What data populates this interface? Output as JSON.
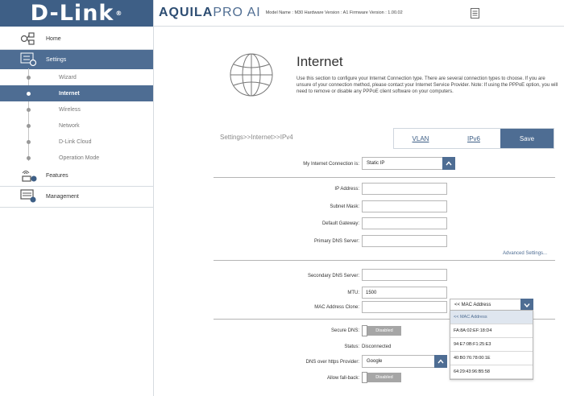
{
  "sidebar": {
    "logo": "D-Link",
    "logo_mark": "®",
    "items": [
      {
        "label": "Home",
        "icon": "home-network-icon"
      },
      {
        "label": "Settings",
        "icon": "settings-gear-icon"
      },
      {
        "label": "Features",
        "icon": "features-wireless-icon"
      },
      {
        "label": "Management",
        "icon": "management-dashboard-icon"
      }
    ],
    "sub_items": [
      "Wizard",
      "Internet",
      "Wireless",
      "Network",
      "D-Link Cloud",
      "Operation Mode"
    ],
    "active_item": "Settings",
    "active_sub_item": "Internet"
  },
  "header": {
    "brand_bold": "AQUILA",
    "brand_thin": "PRO AI",
    "model_info": "Model Name : M30 Hardware Version : A1 Firmware Version : 1.00.02",
    "doc_icon": "document-icon"
  },
  "intro": {
    "icon": "globe-icon",
    "title": "Internet",
    "text": "Use this section to configure your Internet Connection type. There are several connection types to choose. If you are unsure of your connection method, please contact your Internet Service Provider. Note: If using the PPPoE option, you will need to remove or disable any PPPoE client software on your computers."
  },
  "breadcrumb": "Settings>>Internet>>IPv4",
  "buttons": {
    "vlan": "VLAN",
    "ipv6": "IPv6",
    "save": "Save"
  },
  "form": {
    "connection_label": "My Internet Connection is:",
    "connection_value": "Static IP",
    "ip_label": "IP Address:",
    "ip_value": "",
    "subnet_label": "Subnet Mask:",
    "subnet_value": "",
    "gateway_label": "Default Gateway:",
    "gateway_value": "",
    "primary_dns_label": "Primary DNS Server:",
    "primary_dns_value": "",
    "advanced_link": "Advanced Settings...",
    "secondary_dns_label": "Secondary DNS Server:",
    "secondary_dns_value": "",
    "mtu_label": "MTU:",
    "mtu_value": "1500",
    "mac_label": "MAC Address Clone:",
    "mac_value": "",
    "mac_select_value": "<< MAC Address",
    "mac_options": [
      "<< MAC Address",
      "FA:8A:02:EF:18:D4",
      "94:E7:0B:F1:25:E3",
      "40:B0:76:78:00:1E",
      "64:29:43:96:B5:58"
    ],
    "secure_dns_label": "Secure DNS:",
    "secure_dns_value": "Disabled",
    "status_label": "Status:",
    "status_value": "Disconnected",
    "doh_label": "DNS over https Provider:",
    "doh_value": "Google",
    "fallback_label": "Allow fall-back:",
    "fallback_value": "Disabled"
  },
  "colors": {
    "brand": "#3e5f86",
    "active": "#4e6d93",
    "toggle_off": "#a6a6a6"
  }
}
